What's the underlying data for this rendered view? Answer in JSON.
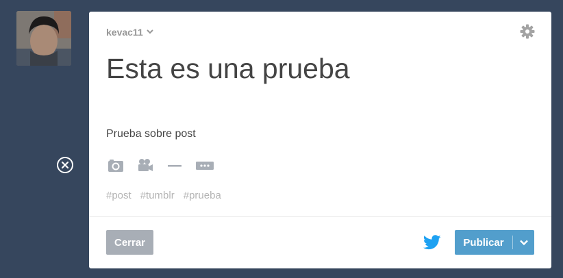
{
  "user": {
    "avatar": "avatar-photo"
  },
  "post": {
    "blog_name": "kevac11",
    "title": "Esta es una prueba",
    "body": "Prueba sobre post",
    "tags": [
      "#post",
      "#tumblr",
      "#prueba"
    ]
  },
  "toolbar": {
    "icons": [
      "camera-icon",
      "video-camera-icon",
      "horizontal-rule-icon",
      "read-more-icon"
    ]
  },
  "footer": {
    "close_label": "Cerrar",
    "publish_label": "Publicar",
    "share_icon": "twitter-icon"
  },
  "colors": {
    "background": "#36465d",
    "publish": "#529ecc",
    "close": "#a8aeb6",
    "twitter": "#1da1f2"
  }
}
